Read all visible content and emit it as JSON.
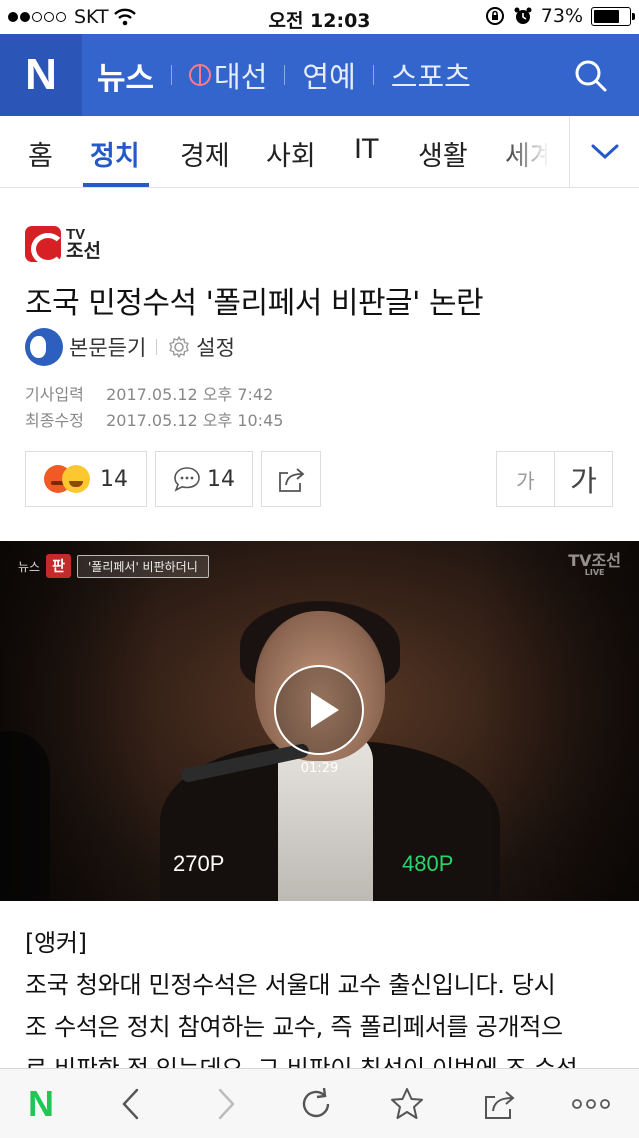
{
  "status_bar": {
    "carrier": "SKT",
    "time": "오전 12:03",
    "battery": "73%",
    "battery_level": 0.73
  },
  "header": {
    "logo": "N",
    "tabs": [
      {
        "label": "뉴스",
        "active": true
      },
      {
        "label": "대선",
        "icon": "peace-icon"
      },
      {
        "label": "연예"
      },
      {
        "label": "스포츠"
      }
    ],
    "accent_color": "#3465cc"
  },
  "categories": {
    "items": [
      "홈",
      "정치",
      "경제",
      "사회",
      "IT",
      "생활",
      "세계"
    ],
    "active": "정치",
    "more_icon": "chevron-down-icon"
  },
  "article": {
    "source": {
      "line1": "TV",
      "line2": "조선"
    },
    "title": "조국 민정수석 '폴리페서 비판글' 논란",
    "listen_label": "본문듣기",
    "settings_label": "설정",
    "published_label": "기사입력",
    "published": "2017.05.12 오후 7:42",
    "modified_label": "최종수정",
    "modified": "2017.05.12 오후 10:45",
    "reactions_count": "14",
    "comments_count": "14",
    "font_small": "가",
    "font_large": "가"
  },
  "video": {
    "program_tag": "뉴스",
    "program_badge": "판",
    "caption": "'폴리페서' 비판하더니",
    "channel_logo": "TV조선",
    "channel_sub": "LIVE",
    "duration": "01:29",
    "quality_options": [
      "270P",
      "480P"
    ],
    "quality_selected": "480P"
  },
  "body": {
    "label": "[앵커]",
    "lines": [
      "조국 청와대 민정수석은 서울대 교수 출신입니다. 당시",
      "조 수석은 정치 참여하는 교수, 즉 폴리페서를 공개적으",
      "로 비판한 적 있는데요, 그 비판이 최선이 이번에 조 수석"
    ]
  },
  "toolbar": {
    "items": [
      "naver-home-icon",
      "back-icon",
      "forward-icon",
      "reload-icon",
      "bookmark-icon",
      "share-icon",
      "more-icon"
    ],
    "home_label": "N"
  }
}
